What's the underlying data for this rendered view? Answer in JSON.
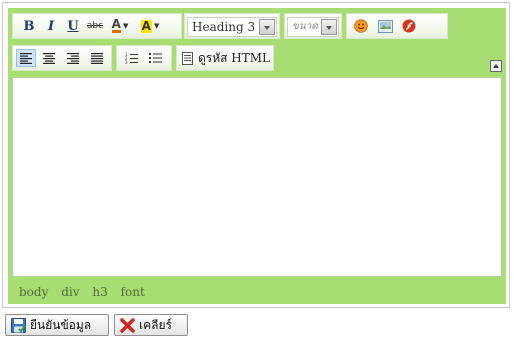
{
  "toolbar": {
    "bold": "B",
    "italic": "I",
    "underline": "U",
    "strike": "abc",
    "font_color": "A",
    "bg_color": "A",
    "format_value": "Heading 3",
    "size_value": "ขนาด",
    "source_label": "ดูรหัส HTML"
  },
  "icons": {
    "bold": "bold-icon",
    "italic": "italic-icon",
    "underline": "underline-icon",
    "strike": "strikethrough-icon",
    "font_color": "font-color-icon",
    "bg_color": "highlight-color-icon",
    "smiley": "smiley-icon",
    "image": "image-icon",
    "flash": "flash-icon",
    "align_left": "align-left-icon",
    "align_center": "align-center-icon",
    "align_right": "align-right-icon",
    "justify": "justify-icon",
    "ordered_list": "numbered-list-icon",
    "bullet_list": "bullet-list-icon",
    "source": "source-icon",
    "collapse": "collapse-toolbar-icon",
    "save": "save-icon",
    "clear": "clear-icon"
  },
  "path": [
    "body",
    "div",
    "h3",
    "font"
  ],
  "buttons": {
    "confirm": "ยืนยันข้อมูล",
    "clear": "เคลียร์"
  },
  "colors": {
    "editor_bg": "#a8dd73",
    "accent_blue": "#cfe3f6",
    "font_color_swatch": "#e06a00",
    "highlight_swatch": "#ffe600"
  }
}
